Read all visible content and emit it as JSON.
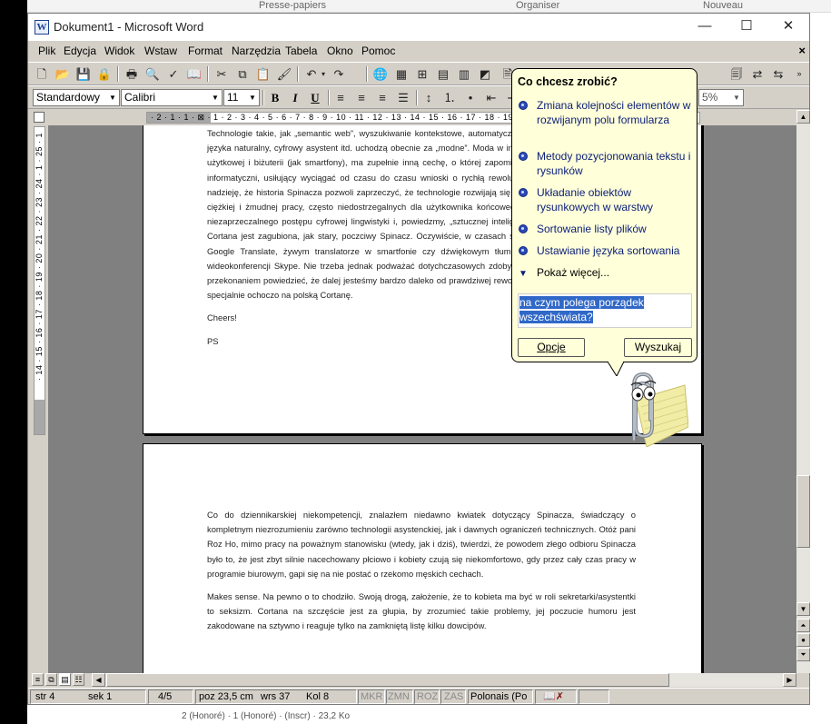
{
  "background": {
    "ribbon_groups": [
      "Presse-papiers",
      "Organiser",
      "Nouveau"
    ],
    "bottom_text": "2 (Honoré) · 1 (Honoré) · (Inscr) · 23,2 Ko"
  },
  "window": {
    "title": "Dokument1 - Microsoft Word",
    "minimize": "—",
    "maximize": "☐",
    "close": "✕"
  },
  "menu": [
    "Plik",
    "Edycja",
    "Widok",
    "Wstaw",
    "Format",
    "Narzędzia",
    "Tabela",
    "Okno",
    "Pomoc"
  ],
  "menu_doc_close": "×",
  "toolbar_format": {
    "style": "Standardowy",
    "font": "Calibri",
    "size": "11",
    "bold": "B",
    "italic": "I",
    "underline": "U",
    "clipped_combo": "5%"
  },
  "ruler": {
    "horizontal": "· 2 · 1 · 1 · ⊠ · 1 · 2 · 3 · 4 · 5 · 6 · 7 · 8 · 9 · 10 · 11 · 12 · 13 · 14 · 15 · 16 · 17 · 18 · 19",
    "vertical": "· 14 · 15 · 16 · 17 · 18 · 19 · 20 · 21 · 22 · 23 · 24 · 1 · 25 · 1"
  },
  "page1": {
    "paragraph": "Technologie takie, jak „semantic web”, wyszukiwanie kontekstowe, automatyczne przetwarzanie języka naturalny, cyfrowy asystent itd. uchodzą obecnie za „modne”. Moda w informatyce czysto użytkowej i biżuterii (jak smartfony), ma zupełnie inną cechę, o której zapominać dziennikarze informatyczni, usiłujący wyciągać od czasu do czasu wnioski o rychłą rewolucję. Mam zatem nadzieję, że historia Spinacza pozwoli zaprzeczyć, że technologie rozwijają się od lat, nakładem ciężkiej i żmudnej pracy, często niedostrzegalnych dla użytkownika końcowego. A więc mimo niezaprzeczalnego postępu cyfrowej lingwistyki i, powiedzmy, „sztucznej inteligencji”, dzisiejsza Cortana jest zagubiona, jak stary, poczciwy Spinacz. Oczywiście, w czasach spinacza nie było Google Translate, żywym translatorze w smartfonie czy dźwiękowym tłumaczeniu podczas wideokonferencji Skype. Nie trzeba jednak podważać dotychczasowych zdobyczy, by z pełnym przekonaniem powiedzieć, że dalej jesteśmy bardzo daleko od prawdziwej rewolucji. Zaczekajmy specjalnie ochoczo na polską Cortanę.",
    "cheers": "Cheers!",
    "ps": "PS"
  },
  "page2": {
    "paragraph1": "Co do dziennikarskiej niekompetencji, znalazłem niedawno kwiatek dotyczący Spinacza, świadczący o kompletnym niezrozumieniu zarówno technologii asystenckiej, jak i dawnych ograniczeń technicznych. Otóż pani Roz Ho, mimo pracy na poważnym stanowisku (wtedy, jak i dziś), twierdzi, że powodem złego odbioru Spinacza było to, że jest zbyt silnie nacechowany płciowo i kobiety czują się niekomfortowo, gdy przez cały czas pracy w programie biurowym, gapi się na nie postać o rzekomo męskich cechach.",
    "paragraph2": "Makes sense. Na pewno o to chodziło. Swoją drogą, założenie, że to kobieta ma być w roli sekretarki/asystentki to seksizm. Cortana na szczęście jest za głupia, by zrozumieć takie problemy, jej poczucie humoru jest zakodowane na sztywno i reaguje tylko na zamkniętą listę kilku dowcipów."
  },
  "assistant": {
    "title": "Co chcesz zrobić?",
    "items": [
      "Zmiana kolejności elementów w rozwijanym polu formularza",
      "Metody pozycjonowania tekstu i rysunków",
      "Układanie obiektów rysunkowych w warstwy",
      "Sortowanie listy plików",
      "Ustawianie języka sortowania"
    ],
    "more": "Pokaż więcej...",
    "query": "na czym polega porządek wszechświata?",
    "options_button": "Opcje",
    "search_button": "Wyszukaj"
  },
  "status": {
    "page": "str 4",
    "section": "sek 1",
    "pages": "4/5",
    "position": "poz 23,5 cm",
    "line": "wrs 37",
    "column": "Kol 8",
    "rec": "MKR",
    "trk": "ZMN",
    "ext": "ROZ",
    "ovr": "ZAS",
    "language": "Polonais (Po"
  },
  "colors": {
    "chrome": "#d4d0c8",
    "balloon": "#ffffd9",
    "link": "#0a1e7a",
    "selection": "#3068c8",
    "workspace": "#808080"
  }
}
